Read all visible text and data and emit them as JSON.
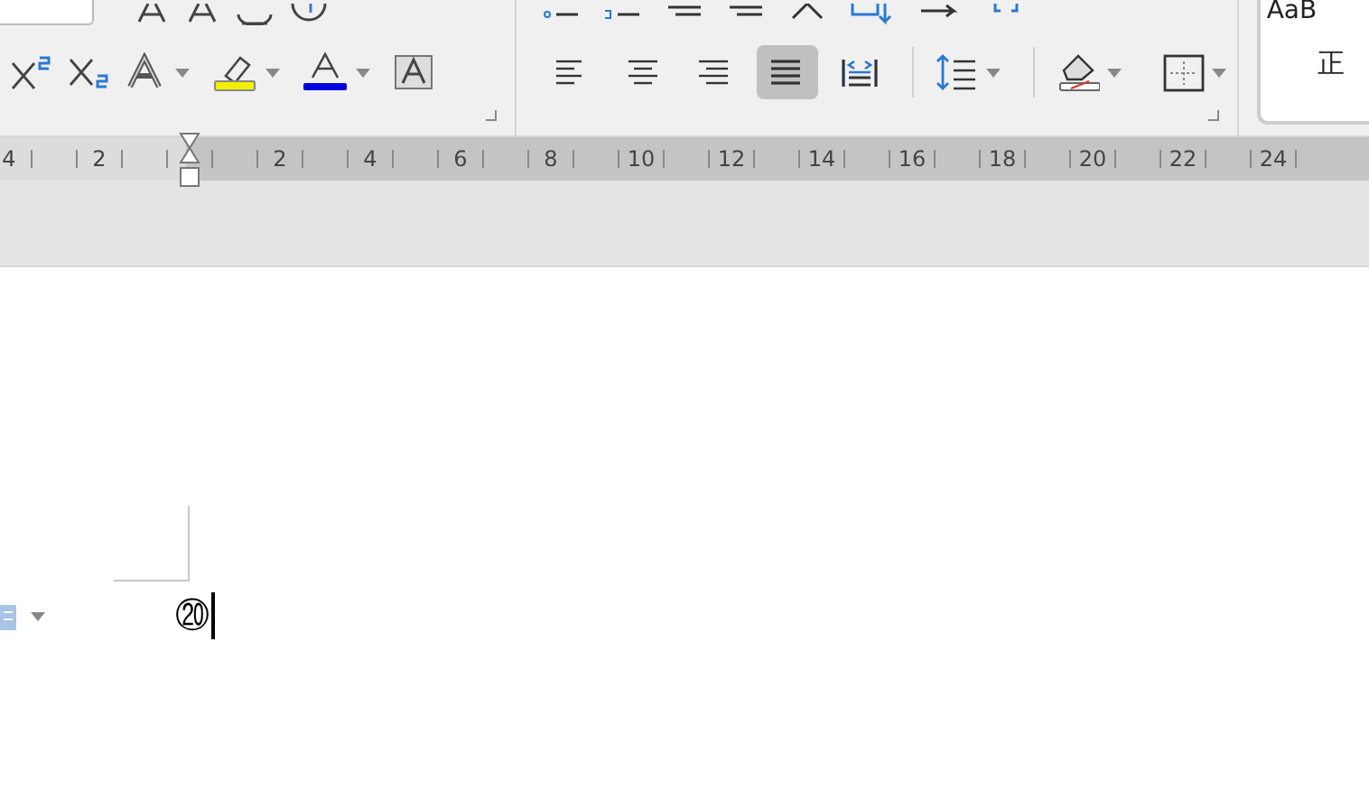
{
  "ribbon": {
    "paragraph_group": {
      "alignment_buttons": [
        {
          "kind": "left",
          "selected": false
        },
        {
          "kind": "center",
          "selected": false
        },
        {
          "kind": "right",
          "selected": false
        },
        {
          "kind": "justify",
          "selected": true
        },
        {
          "kind": "distributed",
          "selected": false
        }
      ]
    },
    "styles": {
      "preview": "AaB",
      "style_name": "正"
    }
  },
  "ruler": {
    "left_labels": [
      "4",
      "2"
    ],
    "labels": [
      "2",
      "4",
      "6",
      "8",
      "10",
      "12",
      "14",
      "16",
      "18",
      "20",
      "22",
      "24"
    ]
  },
  "document": {
    "text": "⑳"
  }
}
